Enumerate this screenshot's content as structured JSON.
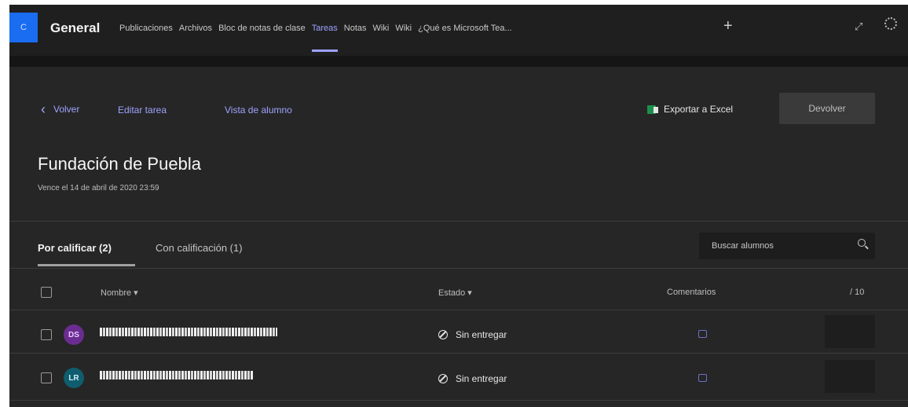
{
  "header": {
    "team_initial": "C",
    "channel_title": "General",
    "tabs": [
      {
        "label": "Publicaciones"
      },
      {
        "label": "Archivos"
      },
      {
        "label": "Bloc de notas de clase"
      },
      {
        "label": "Tareas"
      },
      {
        "label": "Notas"
      },
      {
        "label": "Wiki"
      },
      {
        "label": "Wiki"
      },
      {
        "label": "¿Qué es Microsoft Tea..."
      }
    ],
    "active_tab": "Tareas",
    "add_tab_label": "+",
    "expand_glyph": "⤢",
    "icons": {
      "add": "plus-icon",
      "expand": "expand-icon",
      "refresh": "refresh-icon"
    }
  },
  "actions": {
    "back_label": "Volver",
    "back_glyph": "‹",
    "edit_label": "Editar tarea",
    "student_view_label": "Vista de alumno",
    "export_label": "Exportar a Excel",
    "return_label": "Devolver"
  },
  "assignment": {
    "title": "Fundación de Puebla",
    "due": "Vence el 14 de abril de 2020 23:59"
  },
  "filters": {
    "to_grade": "Por calificar (2)",
    "graded": "Con calificación (1)",
    "search_placeholder": "Buscar alumnos"
  },
  "table": {
    "columns": {
      "name": "Nombre ▾",
      "status": "Estado ▾",
      "comments": "Comentarios",
      "points": "/ 10"
    },
    "rows": [
      {
        "initials": "DS",
        "avatar_color": "#6b2c91",
        "avatar_text_color": "#e8c9ff",
        "status": "Sin entregar"
      },
      {
        "initials": "LR",
        "avatar_color": "#0f5d6e",
        "avatar_text_color": "#cfeff6",
        "status": "Sin entregar"
      }
    ]
  },
  "colors": {
    "background": "#262626",
    "accent": "#9ea2ff",
    "team_avatar": "#1a6cf0",
    "excel_green": "#1d8f4a"
  }
}
